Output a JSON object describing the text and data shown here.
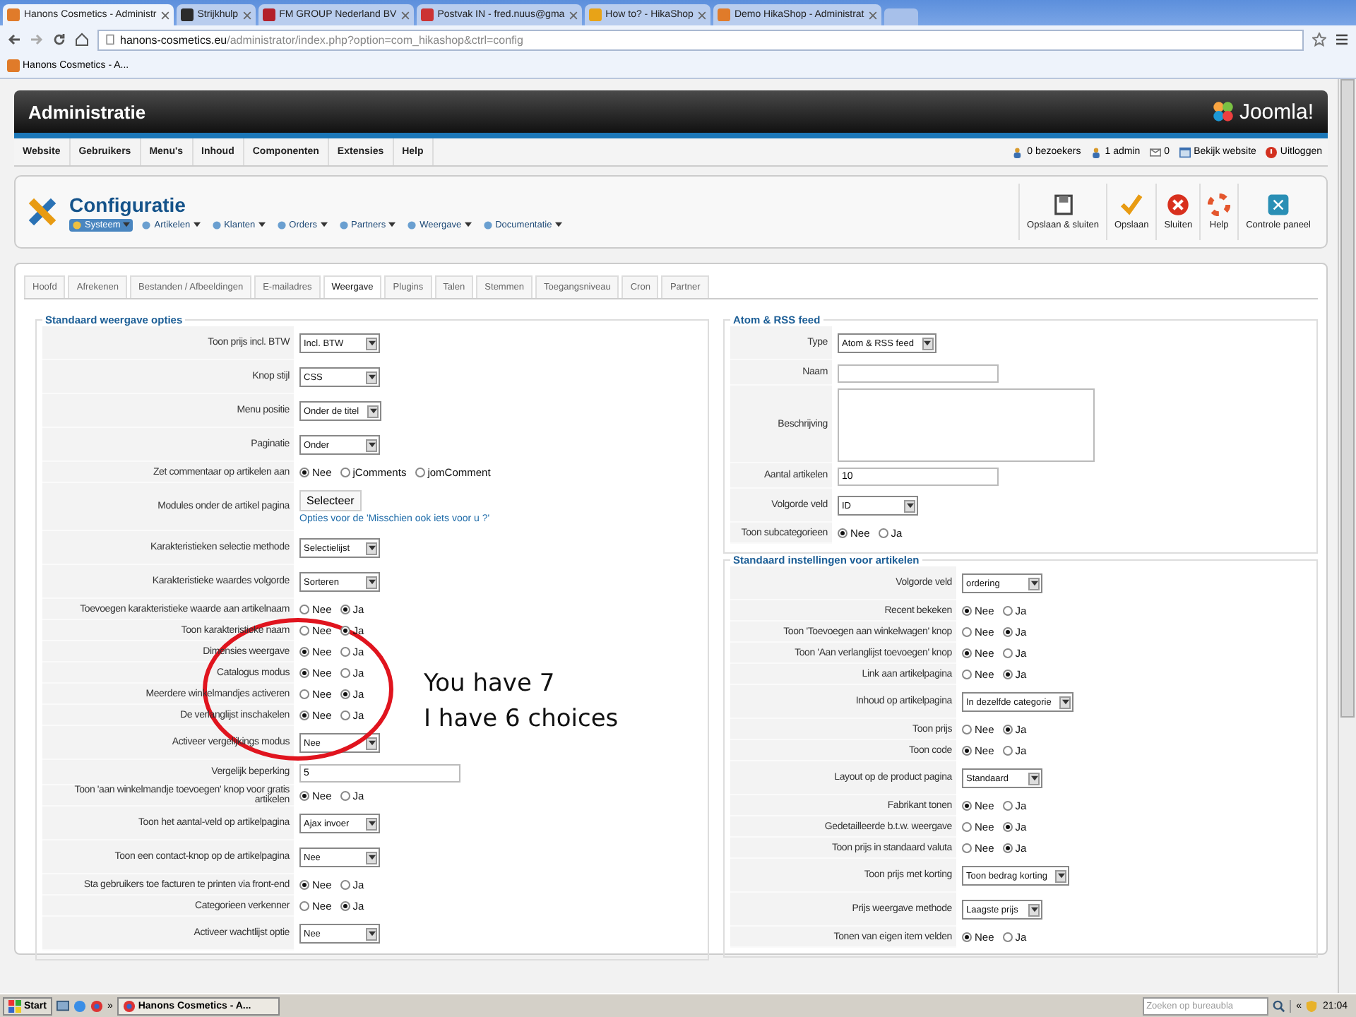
{
  "browser": {
    "tabs": [
      {
        "title": "Hanons Cosmetics - Administr",
        "selected": true
      },
      {
        "title": "Strijkhulp",
        "selected": false
      },
      {
        "title": "FM GROUP Nederland BV",
        "selected": false
      },
      {
        "title": "Postvak IN - fred.nuus@gma",
        "selected": false
      },
      {
        "title": "How to? - HikaShop",
        "selected": false
      },
      {
        "title": "Demo HikaShop - Administrat",
        "selected": false
      }
    ],
    "address_host": "hanons-cosmetics.eu",
    "address_path": "/administrator/index.php?option=com_hikashop&ctrl=config",
    "bookmark": "Hanons Cosmetics - A..."
  },
  "header": {
    "title": "Administratie",
    "logo_text": "Joomla!"
  },
  "menu": [
    "Website",
    "Gebruikers",
    "Menu's",
    "Inhoud",
    "Componenten",
    "Extensies",
    "Help"
  ],
  "status": [
    {
      "kind": "users",
      "label": "0 bezoekers"
    },
    {
      "kind": "admin",
      "label": "1 admin"
    },
    {
      "kind": "mail",
      "label": "0"
    },
    {
      "kind": "site",
      "label": "Bekijk website"
    },
    {
      "kind": "logout",
      "label": "Uitloggen"
    }
  ],
  "toolbar": {
    "title": "Configuratie",
    "submenu": [
      {
        "label": "Systeem",
        "selected": true
      },
      {
        "label": "Artikelen",
        "selected": false
      },
      {
        "label": "Klanten",
        "selected": false
      },
      {
        "label": "Orders",
        "selected": false
      },
      {
        "label": "Partners",
        "selected": false
      },
      {
        "label": "Weergave",
        "selected": false
      },
      {
        "label": "Documentatie",
        "selected": false
      }
    ],
    "actions": [
      {
        "kind": "save-close",
        "label": "Opslaan & sluiten"
      },
      {
        "kind": "save",
        "label": "Opslaan"
      },
      {
        "kind": "close",
        "label": "Sluiten"
      },
      {
        "kind": "help",
        "label": "Help"
      },
      {
        "kind": "panel",
        "label": "Controle paneel"
      }
    ]
  },
  "tabs": [
    {
      "label": "Hoofd",
      "selected": false
    },
    {
      "label": "Afrekenen",
      "selected": false
    },
    {
      "label": "Bestanden / Afbeeldingen",
      "selected": false
    },
    {
      "label": "E-mailadres",
      "selected": false
    },
    {
      "label": "Weergave",
      "selected": true
    },
    {
      "label": "Plugins",
      "selected": false
    },
    {
      "label": "Talen",
      "selected": false
    },
    {
      "label": "Stemmen",
      "selected": false
    },
    {
      "label": "Toegangsniveau",
      "selected": false
    },
    {
      "label": "Cron",
      "selected": false
    },
    {
      "label": "Partner",
      "selected": false
    }
  ],
  "left": {
    "legend": "Standaard weergave opties",
    "rows": [
      {
        "kind": "select",
        "label": "Toon prijs incl. BTW",
        "value": "Incl. BTW"
      },
      {
        "kind": "select",
        "label": "Knop stijl",
        "value": "CSS"
      },
      {
        "kind": "select",
        "label": "Menu positie",
        "value": "Onder de titel"
      },
      {
        "kind": "select",
        "label": "Paginatie",
        "value": "Onder"
      },
      {
        "kind": "radio",
        "label": "Zet commentaar op artikelen aan",
        "options": [
          {
            "label": "Nee",
            "selected": true
          },
          {
            "label": "jComments",
            "selected": false
          },
          {
            "label": "jomComment",
            "selected": false
          }
        ]
      },
      {
        "kind": "button",
        "label": "Modules onder de artikel pagina",
        "button": "Selecteer",
        "link": "Opties voor de 'Misschien ook iets voor u ?'"
      },
      {
        "kind": "select",
        "label": "Karakteristieken selectie methode",
        "value": "Selectielijst"
      },
      {
        "kind": "select",
        "label": "Karakteristieke waardes volgorde",
        "value": "Sorteren"
      },
      {
        "kind": "radio",
        "label": "Toevoegen karakteristieke waarde aan artikelnaam",
        "options": [
          {
            "label": "Nee",
            "selected": false
          },
          {
            "label": "Ja",
            "selected": true
          }
        ]
      },
      {
        "kind": "radio",
        "label": "Toon karakteristieke naam",
        "options": [
          {
            "label": "Nee",
            "selected": false
          },
          {
            "label": "Ja",
            "selected": true
          }
        ]
      },
      {
        "kind": "radio",
        "label": "Dimensies weergave",
        "options": [
          {
            "label": "Nee",
            "selected": true
          },
          {
            "label": "Ja",
            "selected": false
          }
        ]
      },
      {
        "kind": "radio",
        "label": "Catalogus modus",
        "options": [
          {
            "label": "Nee",
            "selected": true
          },
          {
            "label": "Ja",
            "selected": false
          }
        ]
      },
      {
        "kind": "radio",
        "label": "Meerdere winkelmandjes activeren",
        "options": [
          {
            "label": "Nee",
            "selected": false
          },
          {
            "label": "Ja",
            "selected": true
          }
        ]
      },
      {
        "kind": "radio",
        "label": "De verlanglijst inschakelen",
        "options": [
          {
            "label": "Nee",
            "selected": true
          },
          {
            "label": "Ja",
            "selected": false
          }
        ]
      },
      {
        "kind": "select",
        "label": "Activeer vergelijkings modus",
        "value": "Nee"
      },
      {
        "kind": "text",
        "label": "Vergelijk beperking",
        "value": "5"
      },
      {
        "kind": "radio",
        "label": "Toon 'aan winkelmandje toevoegen' knop voor gratis artikelen",
        "options": [
          {
            "label": "Nee",
            "selected": true
          },
          {
            "label": "Ja",
            "selected": false
          }
        ]
      },
      {
        "kind": "select",
        "label": "Toon het aantal-veld op artikelpagina",
        "value": "Ajax invoer"
      },
      {
        "kind": "select",
        "label": "Toon een contact-knop op de artikelpagina",
        "value": "Nee"
      },
      {
        "kind": "radio",
        "label": "Sta gebruikers toe facturen te printen via front-end",
        "options": [
          {
            "label": "Nee",
            "selected": true
          },
          {
            "label": "Ja",
            "selected": false
          }
        ]
      },
      {
        "kind": "radio",
        "label": "Categorieen verkenner",
        "options": [
          {
            "label": "Nee",
            "selected": false
          },
          {
            "label": "Ja",
            "selected": true
          }
        ]
      },
      {
        "kind": "select",
        "label": "Activeer wachtlijst optie",
        "value": "Nee"
      }
    ]
  },
  "right": [
    {
      "legend": "Atom & RSS feed",
      "rows": [
        {
          "kind": "select",
          "label": "Type",
          "value": "Atom & RSS feed"
        },
        {
          "kind": "text",
          "label": "Naam"
        },
        {
          "kind": "textarea",
          "label": "Beschrijving"
        },
        {
          "kind": "text",
          "label": "Aantal artikelen",
          "value": "10"
        },
        {
          "kind": "select",
          "label": "Volgorde veld",
          "value": "ID"
        },
        {
          "kind": "radio",
          "label": "Toon subcategorieen",
          "options": [
            {
              "label": "Nee",
              "selected": true
            },
            {
              "label": "Ja",
              "selected": false
            }
          ]
        }
      ]
    },
    {
      "legend": "Standaard instellingen voor artikelen",
      "rows": [
        {
          "kind": "select",
          "label": "Volgorde veld",
          "value": "ordering"
        },
        {
          "kind": "radio",
          "label": "Recent bekeken",
          "options": [
            {
              "label": "Nee",
              "selected": true
            },
            {
              "label": "Ja",
              "selected": false
            }
          ]
        },
        {
          "kind": "radio",
          "label": "Toon 'Toevoegen aan winkelwagen' knop",
          "options": [
            {
              "label": "Nee",
              "selected": false
            },
            {
              "label": "Ja",
              "selected": true
            }
          ]
        },
        {
          "kind": "radio",
          "label": "Toon 'Aan verlanglijst toevoegen' knop",
          "options": [
            {
              "label": "Nee",
              "selected": true
            },
            {
              "label": "Ja",
              "selected": false
            }
          ]
        },
        {
          "kind": "radio",
          "label": "Link aan artikelpagina",
          "options": [
            {
              "label": "Nee",
              "selected": false
            },
            {
              "label": "Ja",
              "selected": true
            }
          ]
        },
        {
          "kind": "select",
          "label": "Inhoud op artikelpagina",
          "value": "In dezelfde categorie"
        },
        {
          "kind": "radio",
          "label": "Toon prijs",
          "options": [
            {
              "label": "Nee",
              "selected": false
            },
            {
              "label": "Ja",
              "selected": true
            }
          ]
        },
        {
          "kind": "radio",
          "label": "Toon code",
          "options": [
            {
              "label": "Nee",
              "selected": true
            },
            {
              "label": "Ja",
              "selected": false
            }
          ]
        },
        {
          "kind": "select",
          "label": "Layout op de product pagina",
          "value": "Standaard"
        },
        {
          "kind": "radio",
          "label": "Fabrikant tonen",
          "options": [
            {
              "label": "Nee",
              "selected": true
            },
            {
              "label": "Ja",
              "selected": false
            }
          ]
        },
        {
          "kind": "radio",
          "label": "Gedetailleerde b.t.w. weergave",
          "options": [
            {
              "label": "Nee",
              "selected": false
            },
            {
              "label": "Ja",
              "selected": true
            }
          ]
        },
        {
          "kind": "radio",
          "label": "Toon prijs in standaard valuta",
          "options": [
            {
              "label": "Nee",
              "selected": false
            },
            {
              "label": "Ja",
              "selected": true
            }
          ]
        },
        {
          "kind": "select",
          "label": "Toon prijs met korting",
          "value": "Toon bedrag korting"
        },
        {
          "kind": "select",
          "label": "Prijs weergave methode",
          "value": "Laagste prijs"
        },
        {
          "kind": "radio",
          "label": "Tonen van eigen item velden",
          "options": [
            {
              "label": "Nee",
              "selected": true
            },
            {
              "label": "Ja",
              "selected": false
            }
          ]
        }
      ]
    }
  ],
  "annotation": {
    "lines": [
      "You have 7",
      "I have 6 choices"
    ]
  },
  "taskbar": {
    "start": "Start",
    "more_left": "»",
    "window": "Hanons Cosmetics - A...",
    "search_placeholder": "Zoeken op bureaubla",
    "more_right": "«",
    "time": "21:04"
  }
}
